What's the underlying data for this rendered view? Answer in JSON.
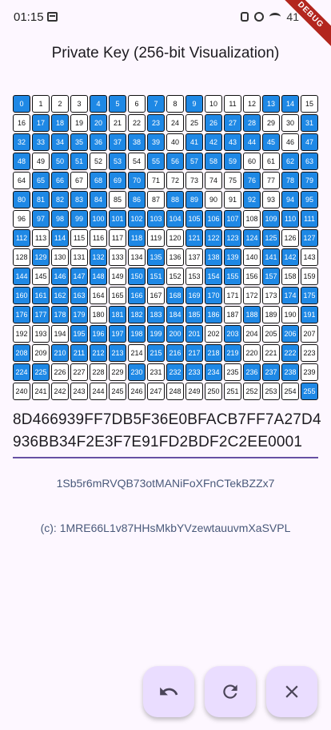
{
  "status": {
    "time": "01:15",
    "battery": "41",
    "debug_label": "DEBUG"
  },
  "title": "Private Key (256-bit Visualization)",
  "grid": {
    "on_color": "#1e88e5",
    "off_color": "#ffffff",
    "bits_hex": "8D466939FF7DB5F36E0BFACB7FF7A27D4936BB34F2E3F7E91FD2BDF2C2EE0001"
  },
  "hex_key": "8D466939FF7DB5F36E0BFACB7FF7A27D4936BB34F2E3F7E91FD2BDF2C2EE0001",
  "address": "1Sb5r6mRVQB73otMANiFoXFnCTekBZZx7",
  "compressed_address": "(c): 1MRE66L1v87HHsMkbYVzewtauuvmXaSVPL",
  "actions": {
    "undo_icon": "undo-icon",
    "refresh_icon": "refresh-icon",
    "close_icon": "close-icon"
  }
}
